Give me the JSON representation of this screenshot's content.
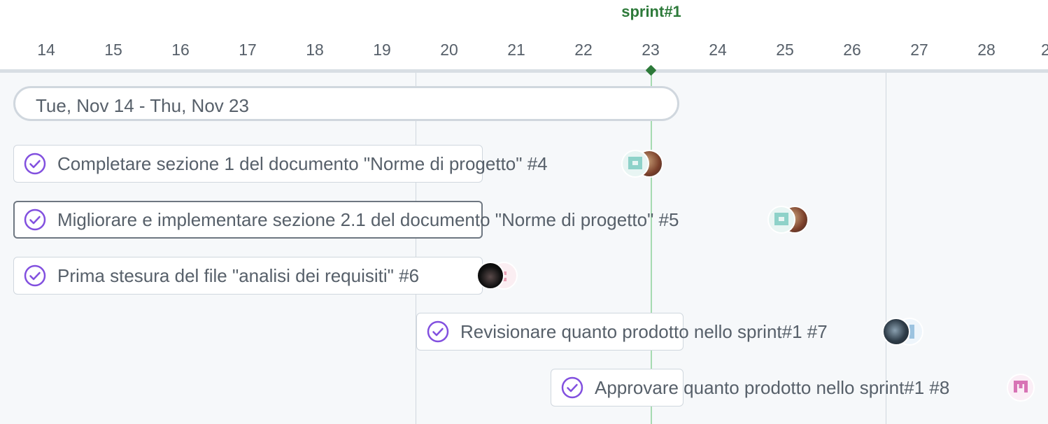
{
  "sprint": {
    "label": "sprint#1",
    "color": "#2d7a3a"
  },
  "days": [
    "14",
    "15",
    "16",
    "17",
    "18",
    "19",
    "20",
    "21",
    "22",
    "23",
    "24",
    "25",
    "26",
    "27",
    "28"
  ],
  "range": {
    "label": "Tue, Nov 14 - Thu, Nov 23"
  },
  "tasks": [
    {
      "title": "Completare sezione 1 del documento \"Norme di progetto\" #4",
      "icon": "check-circle-icon",
      "assignees": [
        "identicon-teal",
        "photo-avatar"
      ]
    },
    {
      "title": "Migliorare e implementare sezione 2.1 del documento \"Norme di progetto\" #5",
      "icon": "check-circle-icon",
      "assignees": [
        "identicon-teal",
        "photo-avatar"
      ]
    },
    {
      "title": "Prima stesura del file \"analisi dei requisiti\" #6",
      "icon": "check-circle-icon",
      "assignees": [
        "dark-photo-avatar",
        "identicon-pink"
      ]
    },
    {
      "title": "Revisionare quanto prodotto nello sprint#1 #7",
      "icon": "check-circle-icon",
      "assignees": [
        "dark-photo-avatar",
        "identicon-blue"
      ]
    },
    {
      "title": "Approvare quanto prodotto nello sprint#1 #8",
      "icon": "check-circle-icon",
      "assignees": [
        "identicon-pink"
      ]
    }
  ],
  "colors": {
    "accent_purple": "#8250df",
    "sprint_green": "#2d7a3a",
    "background": "#f6f8fa"
  }
}
